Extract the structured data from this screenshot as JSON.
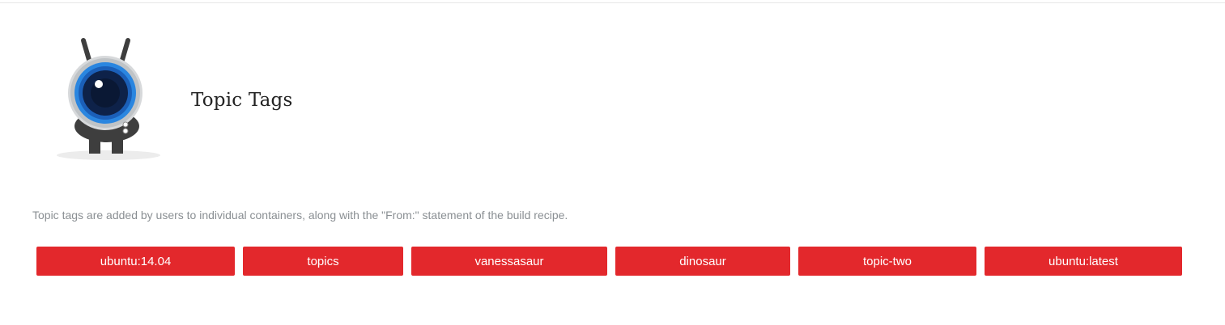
{
  "header": {
    "title": "Topic Tags"
  },
  "description": "Topic tags are added by users to individual containers, along with the \"From:\" statement of the build recipe.",
  "tags": [
    {
      "label": "ubuntu:14.04"
    },
    {
      "label": "topics"
    },
    {
      "label": "vanessasaur"
    },
    {
      "label": "dinosaur"
    },
    {
      "label": "topic-two"
    },
    {
      "label": "ubuntu:latest"
    }
  ],
  "colors": {
    "tag_background": "#e3282c",
    "tag_text": "#ffffff",
    "description_text": "#8a8f93"
  },
  "icons": {
    "logo": "robot-eye-mascot-icon"
  }
}
